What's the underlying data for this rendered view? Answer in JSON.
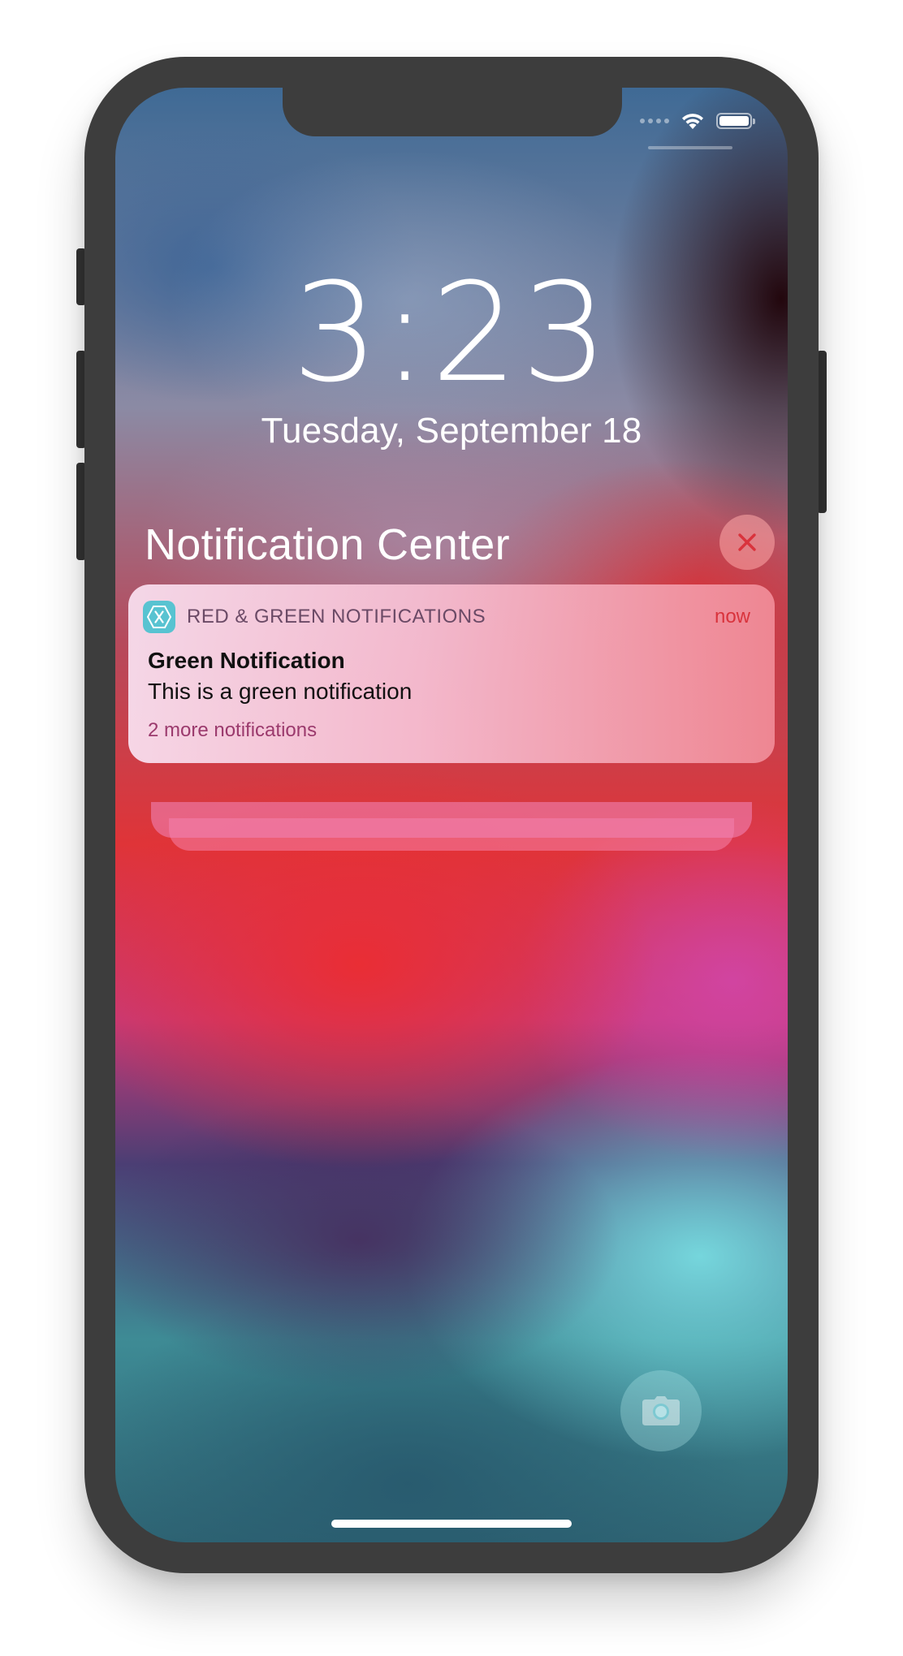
{
  "lock_screen": {
    "time": "3:23",
    "date": "Tuesday, September 18"
  },
  "status_bar": {
    "icons": [
      "signal-dots-icon",
      "wifi-icon",
      "battery-icon"
    ]
  },
  "notification_center": {
    "title": "Notification Center",
    "close_icon": "close-x-icon"
  },
  "notification": {
    "app_icon": "xamarin-x-icon",
    "app_name": "RED & GREEN NOTIFICATIONS",
    "time": "now",
    "title": "Green Notification",
    "body": "This is a green notification",
    "more": "2 more notifications"
  },
  "camera": {
    "icon": "camera-icon"
  },
  "colors": {
    "phone_frame": "#3d3d3d",
    "notif_time": "#d9333c",
    "notif_more": "#9b3a6d",
    "app_icon_bg": "#58c3d1",
    "close_button_x": "#d9333c"
  }
}
